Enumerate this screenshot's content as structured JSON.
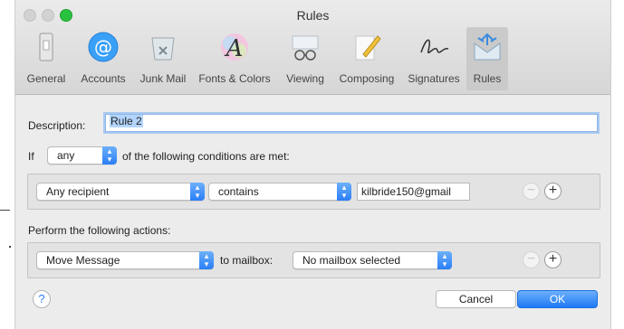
{
  "window": {
    "title": "Rules"
  },
  "toolbar": {
    "items": [
      {
        "label": "General",
        "icon": "general-icon"
      },
      {
        "label": "Accounts",
        "icon": "at-sign-icon"
      },
      {
        "label": "Junk Mail",
        "icon": "trash-icon"
      },
      {
        "label": "Fonts & Colors",
        "icon": "fonts-colors-icon"
      },
      {
        "label": "Viewing",
        "icon": "glasses-icon"
      },
      {
        "label": "Composing",
        "icon": "pencil-icon"
      },
      {
        "label": "Signatures",
        "icon": "signature-icon"
      },
      {
        "label": "Rules",
        "icon": "rules-envelope-icon"
      }
    ],
    "active": "Rules"
  },
  "description": {
    "label": "Description:",
    "value": "Rule 2"
  },
  "condition_header": {
    "if_label": "If",
    "match_value": "any",
    "suffix": "of the following conditions are met:"
  },
  "condition": {
    "field": "Any recipient",
    "operator": "contains",
    "value": "kilbride150@gmail"
  },
  "actions_label": "Perform the following actions:",
  "action": {
    "type": "Move Message",
    "to_label": "to mailbox:",
    "mailbox": "No mailbox selected"
  },
  "buttons": {
    "help": "?",
    "cancel": "Cancel",
    "ok": "OK",
    "minus": "−",
    "plus": "+"
  },
  "colors": {
    "accent": "#2a7ef6",
    "close_active": "#29c23f"
  }
}
